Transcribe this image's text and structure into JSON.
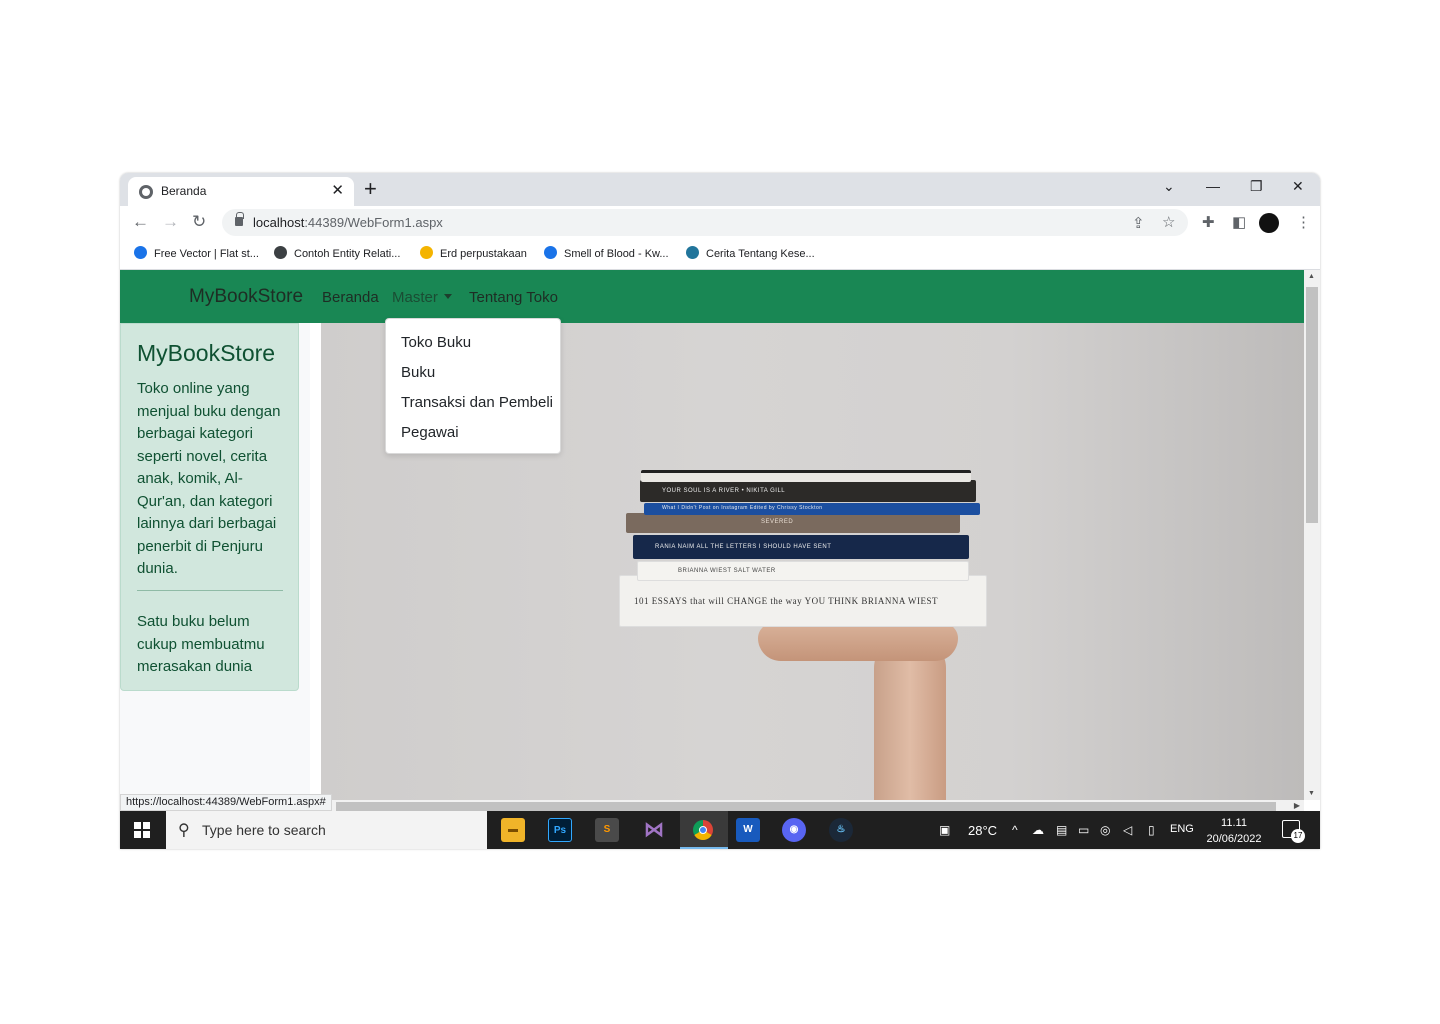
{
  "browser": {
    "tab_title": "Beranda",
    "tab_close": "✕",
    "new_tab": "+",
    "url_host": "localhost",
    "url_rest": ":44389/WebForm1.aspx",
    "status_url": "https://localhost:44389/WebForm1.aspx#",
    "bookmarks": [
      {
        "label": "Free Vector | Flat st...",
        "color": "#1a73e8"
      },
      {
        "label": "Contoh Entity Relati...",
        "color": "#3c4043"
      },
      {
        "label": "Erd perpustakaan",
        "color": "#f4b400"
      },
      {
        "label": "Smell of Blood - Kw...",
        "color": "#1a73e8"
      },
      {
        "label": "Cerita Tentang Kese...",
        "color": "#21759b"
      }
    ]
  },
  "site": {
    "brand": "MyBookStore",
    "nav": {
      "beranda": "Beranda",
      "master": "Master",
      "tentang": "Tentang Toko"
    },
    "dropdown": [
      "Toko Buku",
      "Buku",
      "Transaksi dan Pembeli",
      "Pegawai"
    ],
    "card": {
      "title": "MyBookStore",
      "description": "Toko online yang menjual buku dengan berbagai kategori seperti novel, cerita anak, komik, Al-Qur'an, dan kategori lainnya dari berbagai penerbit di Penjuru dunia.",
      "quote": "Satu buku belum cukup membuatmu merasakan dunia"
    },
    "hero_books": [
      "YOUR SOUL IS A RIVER  •  NIKITA GILL",
      "What I Didn't Post on Instagram      Edited by Chrissy Stockton",
      "SEVERED",
      "RANIA NAIM          ALL THE LETTERS I SHOULD HAVE SENT",
      "BRIANNA WIEST               SALT WATER",
      "101 ESSAYS that will CHANGE the way YOU THINK    BRIANNA WIEST"
    ]
  },
  "taskbar": {
    "search_placeholder": "Type here to search",
    "temperature": "28°C",
    "language": "ENG",
    "time": "11.11",
    "date": "20/06/2022",
    "notifications": "17"
  },
  "colors": {
    "navbar": "#198754",
    "card_bg": "#d1e7dd",
    "card_text": "#0f5132"
  }
}
